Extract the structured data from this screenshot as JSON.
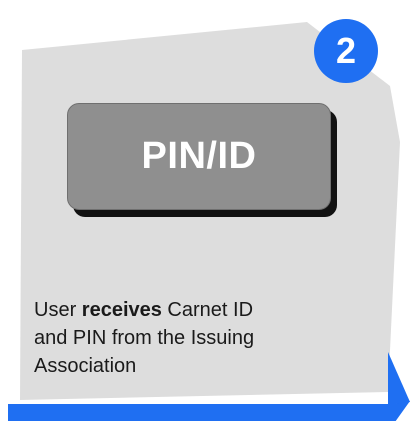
{
  "step": {
    "number": "2"
  },
  "pin_box": {
    "label": "PIN/ID"
  },
  "description": {
    "prefix": "User ",
    "emphasis": "receives",
    "line1_rest": " Carnet ID",
    "line2": "and PIN from the Issuing",
    "line3": "Association"
  },
  "colors": {
    "card_fill": "#dddddd",
    "accent_blue": "#1f6ff2",
    "box_fill": "#8f8f8f",
    "box_shadow": "#111111"
  }
}
